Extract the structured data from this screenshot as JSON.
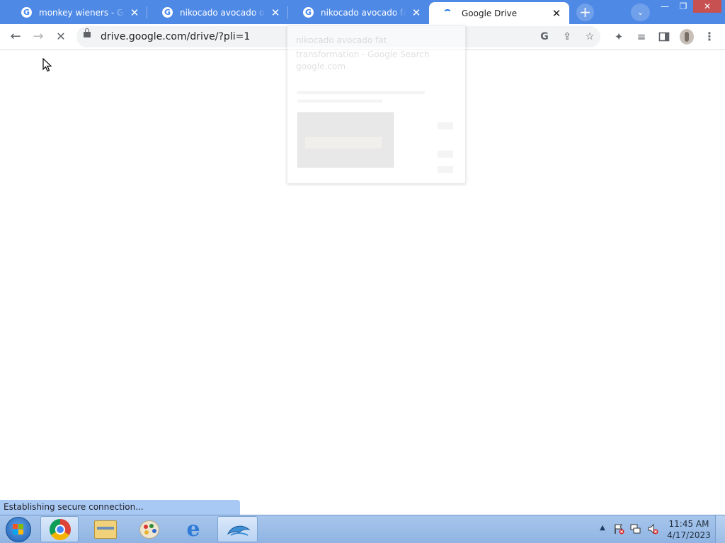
{
  "browser": {
    "tabs": [
      {
        "title": "monkey wieners - Google Search",
        "favicon": "google-g-icon",
        "active": false
      },
      {
        "title": "nikocado avocado onlyfans - Google Search",
        "favicon": "google-g-icon",
        "active": false
      },
      {
        "title": "nikocado avocado fat transformation - Google Search",
        "favicon": "google-g-icon",
        "active": false
      },
      {
        "title": "Google Drive",
        "favicon": "loading-spinner-icon",
        "active": true
      }
    ],
    "tab_close_glyph": "✕",
    "new_tab_glyph": "+",
    "tab_search_glyph": "⌄",
    "window_controls": {
      "minimize": "—",
      "maximize": "❐",
      "close": "✕"
    },
    "toolbar": {
      "back_glyph": "←",
      "forward_glyph": "→",
      "stop_glyph": "✕",
      "url": "drive.google.com/drive/?pli=1"
    },
    "hover_card": {
      "title": "nikocado avocado fat transformation - Google Search",
      "domain": "google.com"
    },
    "status_text": "Establishing secure connection..."
  },
  "taskbar": {
    "pinned": [
      {
        "name": "chrome-icon",
        "active": true
      },
      {
        "name": "windows-explorer-icon",
        "active": false
      },
      {
        "name": "paint-icon",
        "active": false
      },
      {
        "name": "internet-explorer-icon",
        "active": false
      },
      {
        "name": "dolphin-emulator-icon",
        "active": true
      }
    ],
    "clock": {
      "time": "11:45 AM",
      "date": "4/17/2023"
    }
  },
  "colors": {
    "tab_strip": "#4e89e6",
    "spinner": "#1a73e8",
    "status_bubble": "#a9c9f5",
    "taskbar": "#a7c6ec"
  }
}
